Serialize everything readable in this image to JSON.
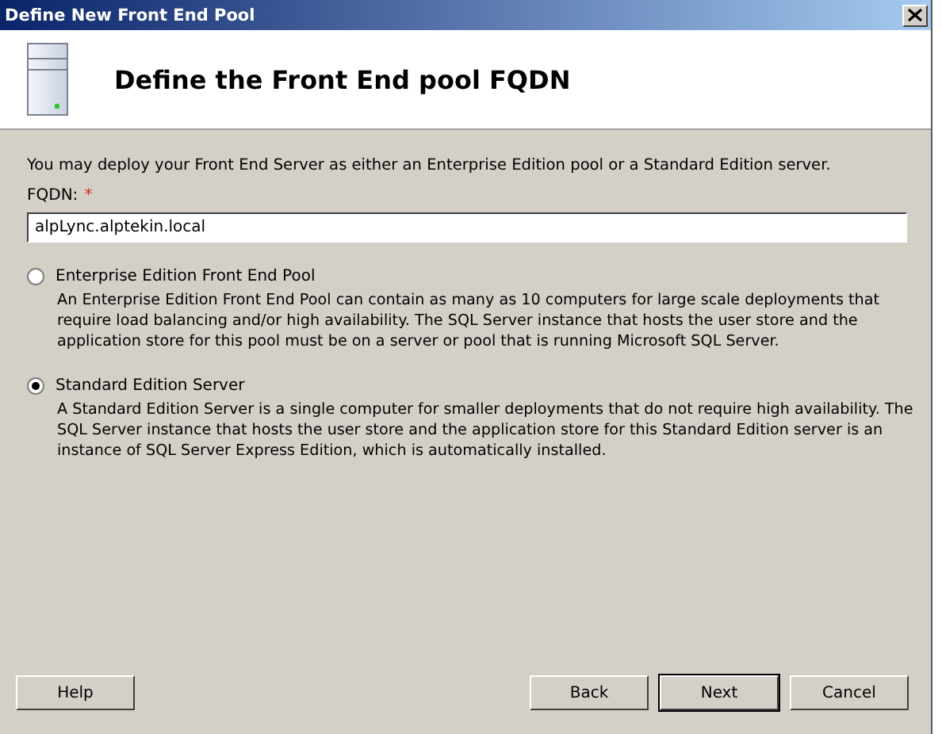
{
  "window": {
    "title": "Define New Front End Pool"
  },
  "header": {
    "title": "Define the Front End pool FQDN"
  },
  "intro": "You may deploy your Front End Server as either an Enterprise Edition pool or a Standard Edition server.",
  "fqdn": {
    "label": "FQDN:",
    "required_mark": "*",
    "value": "alpLync.alptekin.local"
  },
  "options": [
    {
      "label": "Enterprise Edition Front End Pool",
      "description": "An Enterprise Edition Front End Pool can contain as many as 10 computers for large scale deployments that require load balancing and/or high availability.  The SQL Server instance that hosts the user store and the application store for this pool must be on a server or pool that is running Microsoft SQL Server.",
      "selected": false
    },
    {
      "label": "Standard Edition Server",
      "description": "A Standard Edition Server is a single computer for smaller deployments that do not require high availability. The SQL Server instance that hosts the user store and the application store for this Standard Edition server is an instance of SQL Server Express Edition, which is automatically installed.",
      "selected": true
    }
  ],
  "buttons": [
    {
      "label": "Help",
      "default": false
    },
    {
      "label": "Back",
      "default": false
    },
    {
      "label": "Next",
      "default": true
    },
    {
      "label": "Cancel",
      "default": false
    }
  ]
}
